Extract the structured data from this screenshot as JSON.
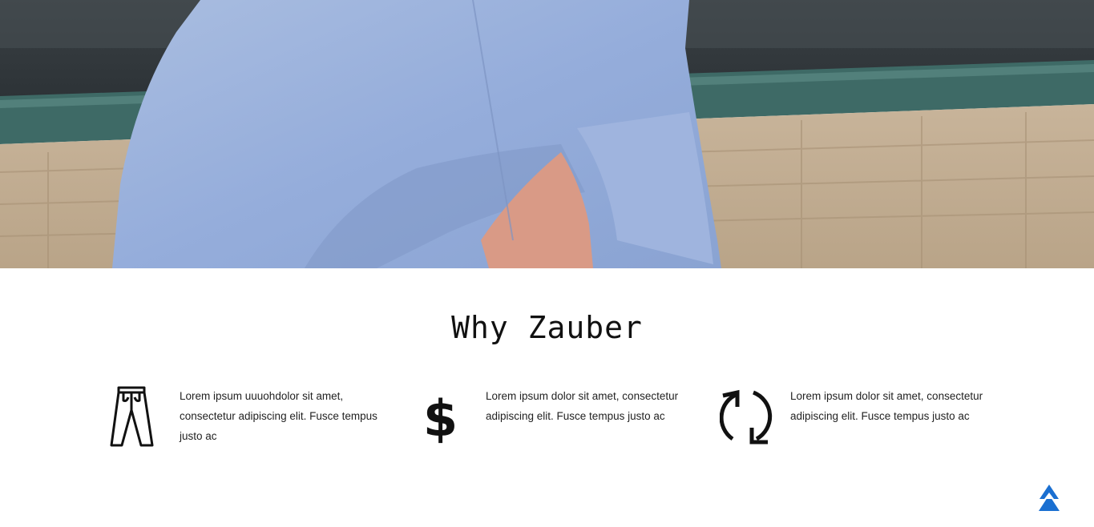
{
  "hero": {
    "image_alt": "Person in light blue denim shirt"
  },
  "section": {
    "title": "Why Zauber"
  },
  "features": [
    {
      "icon": "pants-icon",
      "text": "Lorem ipsum uuuohdolor sit amet, consectetur adipiscing elit. Fusce tempus justo ac"
    },
    {
      "icon": "dollar-icon",
      "text": "Lorem ipsum dolor sit amet, consectetur adipiscing elit. Fusce tempus justo ac"
    },
    {
      "icon": "refresh-icon",
      "text": "Lorem ipsum dolor sit amet, consectetur adipiscing elit. Fusce tempus justo ac"
    }
  ],
  "colors": {
    "accent": "#1a6fd1",
    "text": "#222222"
  },
  "scroll_top": {
    "icon": "double-chevron-up-icon"
  }
}
